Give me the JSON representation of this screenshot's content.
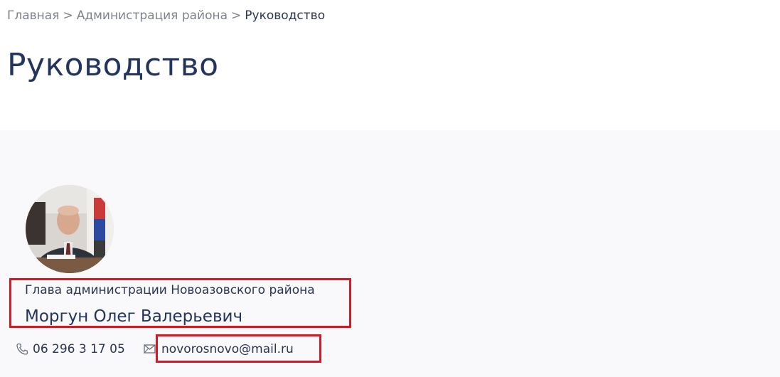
{
  "breadcrumb": {
    "items": [
      "Главная",
      "Администрация района"
    ],
    "separator": ">",
    "current": "Руководство"
  },
  "page": {
    "title": "Руководство"
  },
  "person": {
    "position": "Глава администрации Новоазовского района",
    "name": "Моргун Олег Валерьевич",
    "phone": "06 296 3 17 05",
    "email": "novorosnovo@mail.ru"
  },
  "icons": {
    "phone": "phone-icon",
    "mail": "mail-icon"
  },
  "colors": {
    "title": "#23355e",
    "breadcrumb_link": "#7d828c",
    "text": "#2b3450",
    "highlight": "#e0141e",
    "content_background": "#f9f9fb"
  }
}
